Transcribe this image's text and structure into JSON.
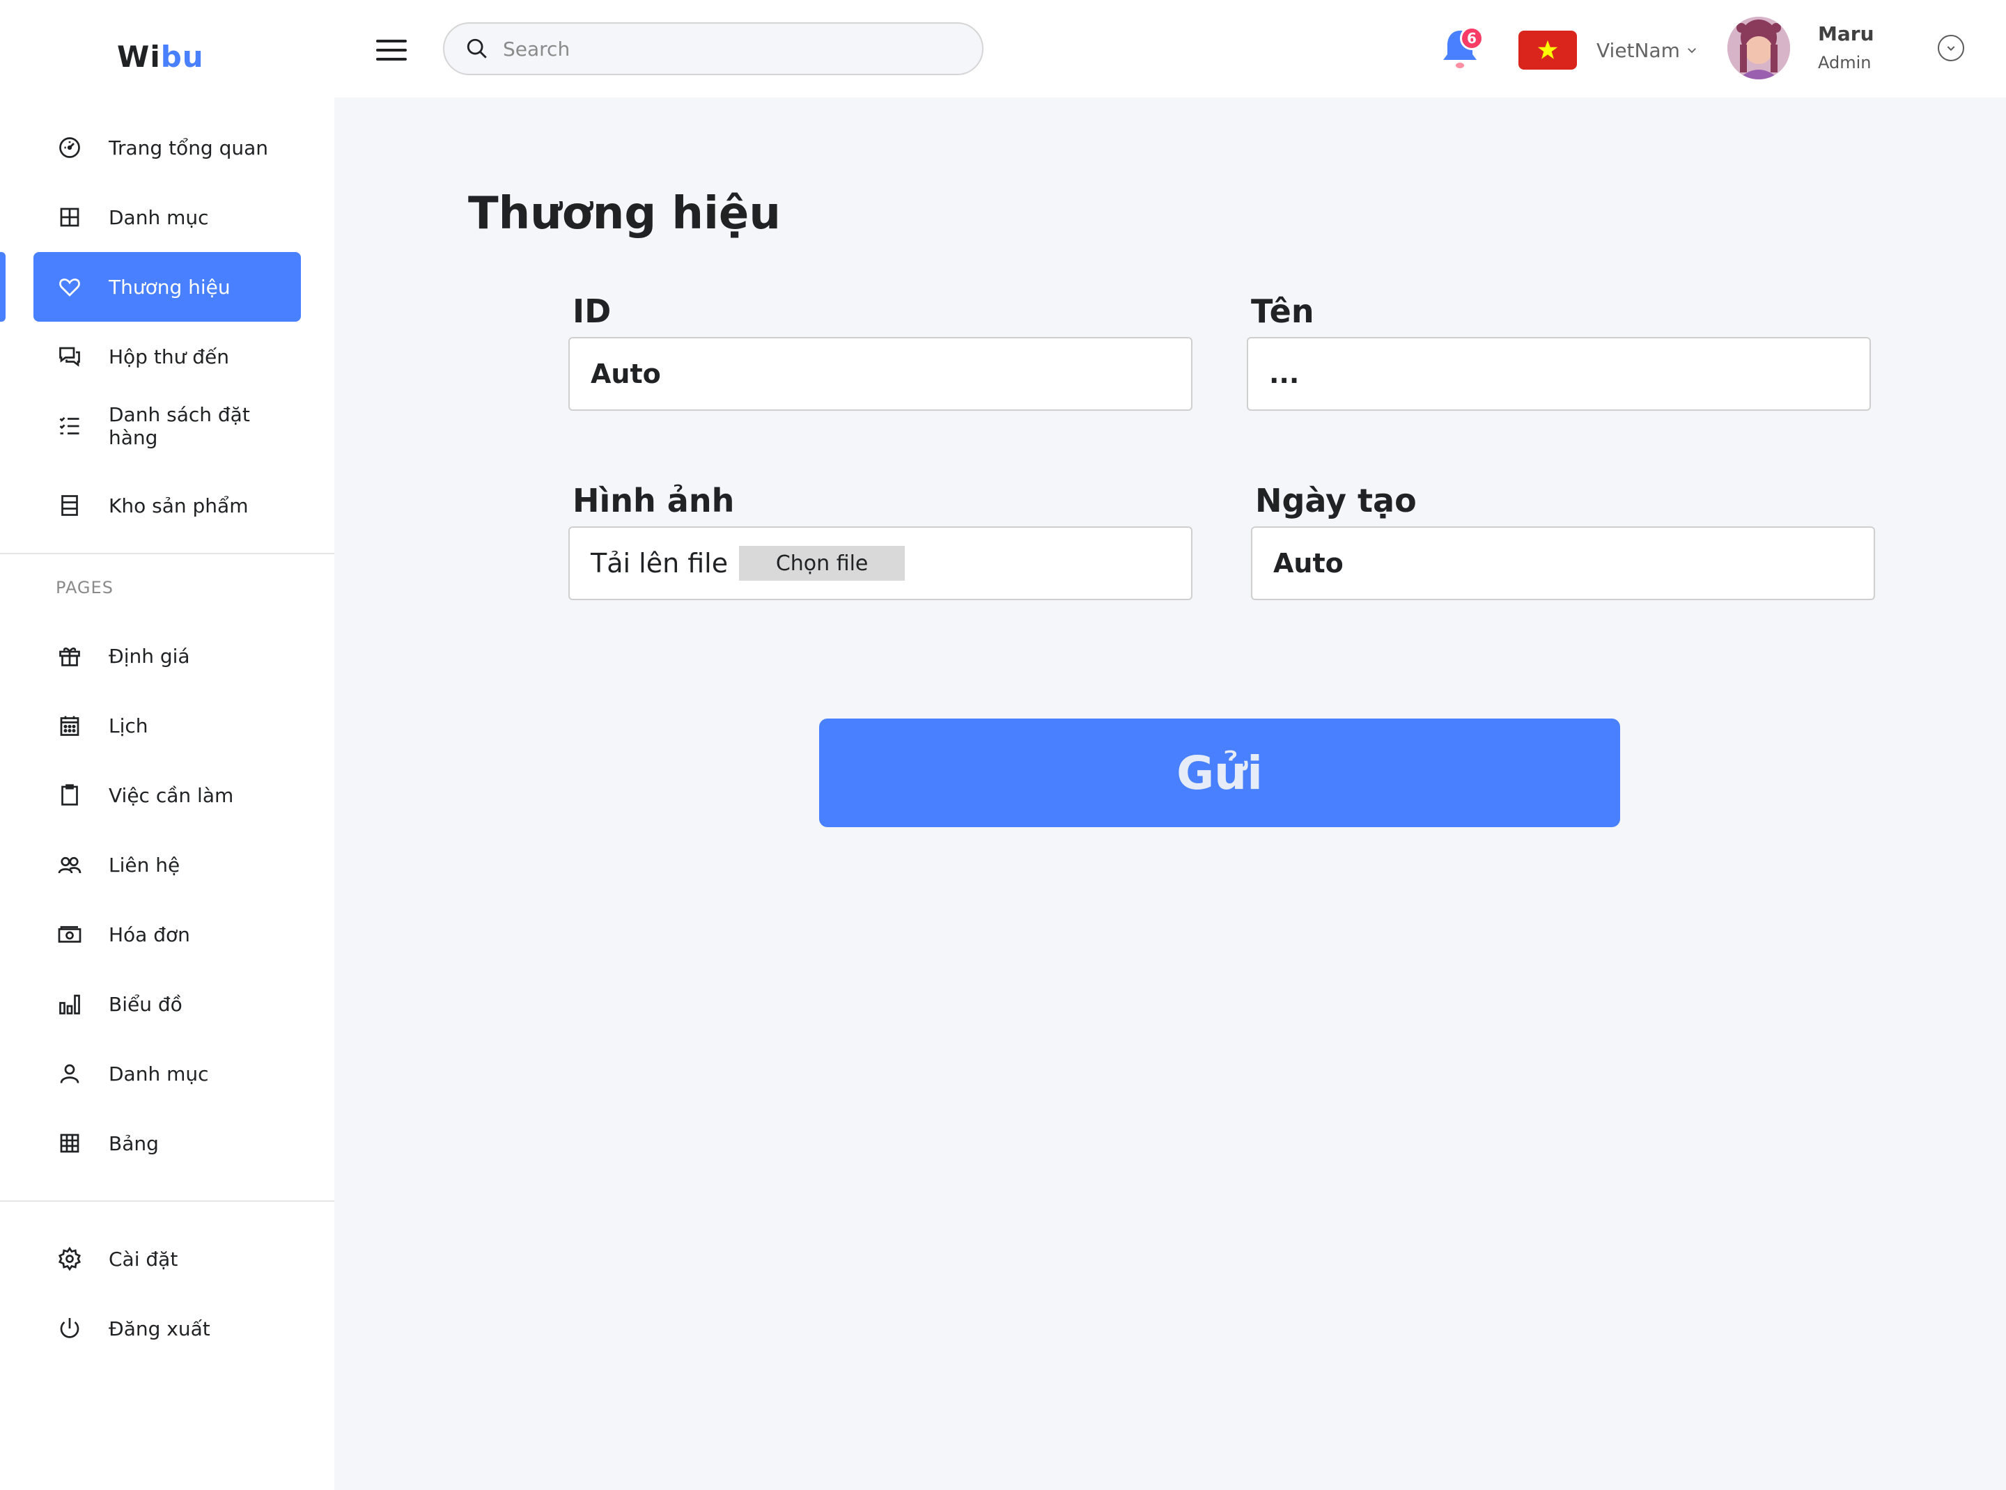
{
  "brand": {
    "part1": "Wi",
    "part2": "bu"
  },
  "header": {
    "search_placeholder": "Search",
    "notification_count": "6",
    "language": "VietNam",
    "user_name": "Maru",
    "user_role": "Admin"
  },
  "sidebar": {
    "main_items": [
      {
        "label": "Trang tổng quan",
        "icon": "dashboard-icon"
      },
      {
        "label": "Danh mục",
        "icon": "grid-icon"
      },
      {
        "label": "Thương hiệu",
        "icon": "heart-icon",
        "active": true
      },
      {
        "label": "Hộp thư đến",
        "icon": "chat-icon"
      },
      {
        "label": "Danh sách đặt hàng",
        "icon": "list-check-icon"
      },
      {
        "label": "Kho sản phẩm",
        "icon": "stock-icon"
      }
    ],
    "pages_title": "PAGES",
    "page_items": [
      {
        "label": "Định giá",
        "icon": "gift-icon"
      },
      {
        "label": "Lịch",
        "icon": "calendar-icon"
      },
      {
        "label": "Việc cần làm",
        "icon": "clipboard-icon"
      },
      {
        "label": "Liên hệ",
        "icon": "contacts-icon"
      },
      {
        "label": "Hóa đơn",
        "icon": "invoice-icon"
      },
      {
        "label": "Biểu đồ",
        "icon": "chart-icon"
      },
      {
        "label": "Danh mục",
        "icon": "user-icon"
      },
      {
        "label": "Bảng",
        "icon": "table-icon"
      }
    ],
    "bottom_items": [
      {
        "label": "Cài đặt",
        "icon": "settings-icon"
      },
      {
        "label": "Đăng xuất",
        "icon": "power-icon"
      }
    ]
  },
  "form": {
    "title": "Thương hiệu",
    "id_label": "ID",
    "id_value": "Auto",
    "name_label": "Tên",
    "name_value": "...",
    "image_label": "Hình ảnh",
    "upload_text": "Tải lên file",
    "choose_file": "Chọn file",
    "created_label": "Ngày tạo",
    "created_value": "Auto",
    "submit": "Gửi"
  },
  "colors": {
    "accent": "#4880ff",
    "badge": "#f93c65",
    "background": "#f5f6fa",
    "flag_red": "#da251d",
    "flag_star": "#ffff00"
  }
}
